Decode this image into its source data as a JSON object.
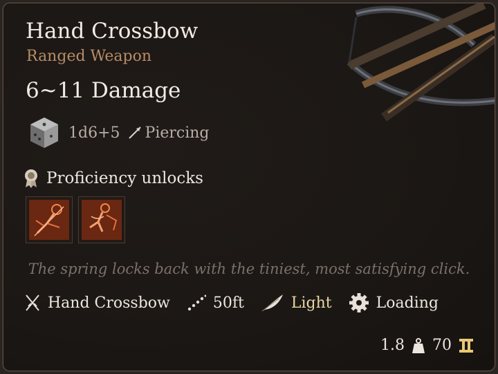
{
  "item": {
    "name": "Hand Crossbow",
    "category": "Ranged Weapon",
    "damage_range": "6~11 Damage",
    "damage_dice": "1d6+5",
    "damage_type": "Piercing"
  },
  "proficiency": {
    "label": "Proficiency unlocks",
    "actions": [
      {
        "icon": "piercing-shot-icon"
      },
      {
        "icon": "hamstring-shot-icon"
      }
    ]
  },
  "flavor_text": "The spring locks back with the tiniest, most satisfying click.",
  "properties": {
    "weapon_type": "Hand Crossbow",
    "range": "50ft",
    "weight_class": "Light",
    "special": "Loading"
  },
  "footer": {
    "weight": "1.8",
    "value": "70"
  },
  "colors": {
    "background": "#1b1714",
    "title": "#f1ebe4",
    "subtitle": "#b78c66",
    "light_property": "#e9d79f",
    "gold": "#e8c877"
  }
}
